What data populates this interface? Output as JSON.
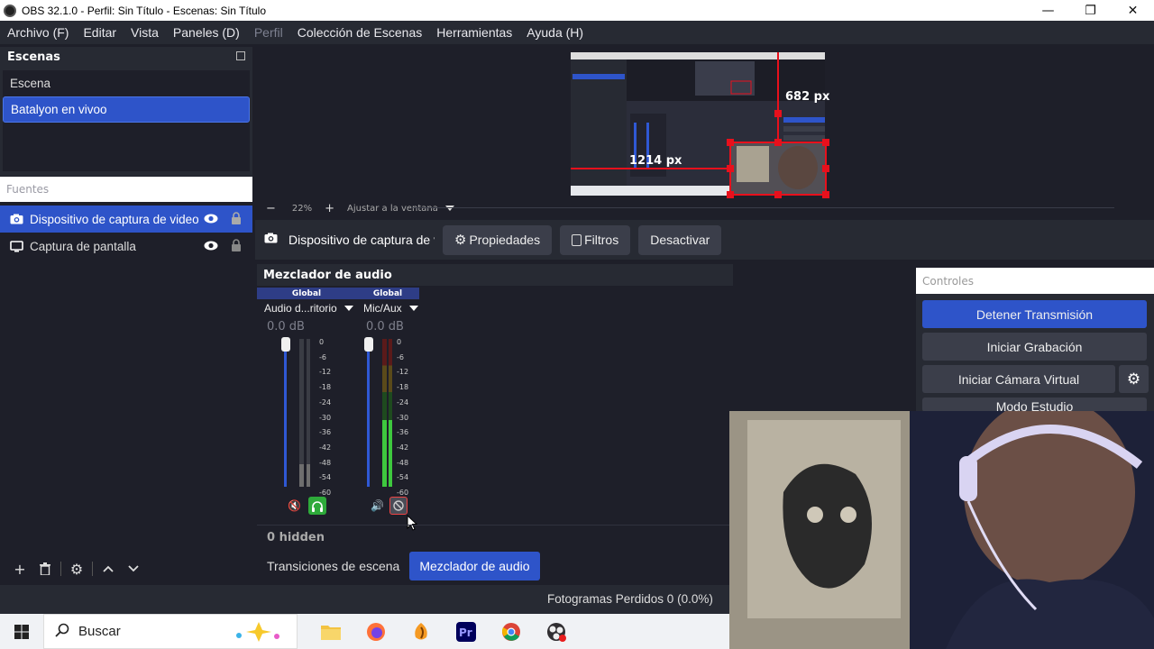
{
  "window": {
    "title": "OBS 32.1.0 - Perfil: Sin Título - Escenas: Sin Título",
    "minimize": "—",
    "restore": "❐",
    "close": "✕"
  },
  "menu": [
    "Archivo (F)",
    "Editar",
    "Vista",
    "Paneles (D)",
    "Perfil",
    "Colección de Escenas",
    "Herramientas",
    "Ayuda (H)"
  ],
  "scenes": {
    "title": "Escenas",
    "items": [
      {
        "label": "Escena",
        "selected": false
      },
      {
        "label": "Batalyon en vivoo",
        "selected": true
      }
    ]
  },
  "sources": {
    "title": "Fuentes",
    "items": [
      {
        "label": "Dispositivo de captura de video",
        "icon": "camera-icon",
        "selected": true
      },
      {
        "label": "Captura de pantalla",
        "icon": "monitor-icon",
        "selected": false
      }
    ]
  },
  "preview": {
    "width_label": "682 px",
    "height_label": "1214 px",
    "zoom": "22%",
    "fit_label": "Ajustar a la ventana",
    "zoom_minus": "−",
    "zoom_plus": "+"
  },
  "context_bar": {
    "source_name": "Dispositivo de captura de video",
    "properties": "Propiedades",
    "filters": "Filtros",
    "deactivate": "Desactivar"
  },
  "mixer": {
    "title": "Mezclador de audio",
    "channels": [
      {
        "global": "Global",
        "name": "Audio d...ritorio",
        "db": "0.0 dB",
        "level": 0.15,
        "muted": true,
        "monitor": "on"
      },
      {
        "global": "Global",
        "name": "Mic/Aux",
        "db": "0.0 dB",
        "level": 0.45,
        "muted": false,
        "monitor": "off"
      }
    ],
    "ticks": [
      "0",
      "-6",
      "-12",
      "-18",
      "-24",
      "-30",
      "-36",
      "-42",
      "-48",
      "-54",
      "-60"
    ],
    "hidden": "0 hidden"
  },
  "dock_tabs": [
    {
      "label": "Transiciones de escena",
      "active": false
    },
    {
      "label": "Mezclador de audio",
      "active": true
    }
  ],
  "status": {
    "dropped_frames": "Fotogramas Perdidos 0 (0.0%)"
  },
  "controls": {
    "title": "Controles",
    "stop_stream": "Detener Transmisión",
    "start_recording": "Iniciar Grabación",
    "start_virtual_cam": "Iniciar Cámara Virtual",
    "studio_mode": "Modo Estudio"
  },
  "taskbar": {
    "search": "Buscar",
    "apps": [
      "file-explorer-icon",
      "firefox-icon",
      "fl-studio-icon",
      "premiere-icon",
      "chrome-icon",
      "obs-icon"
    ]
  },
  "colors": {
    "accent": "#2e54c9",
    "panel": "#272a33",
    "background": "#1e1f29",
    "bounding_box": "#e8101c",
    "meter_green": "#3ec83e",
    "meter_yellow": "#c8a92e",
    "meter_red": "#b31c1c"
  }
}
